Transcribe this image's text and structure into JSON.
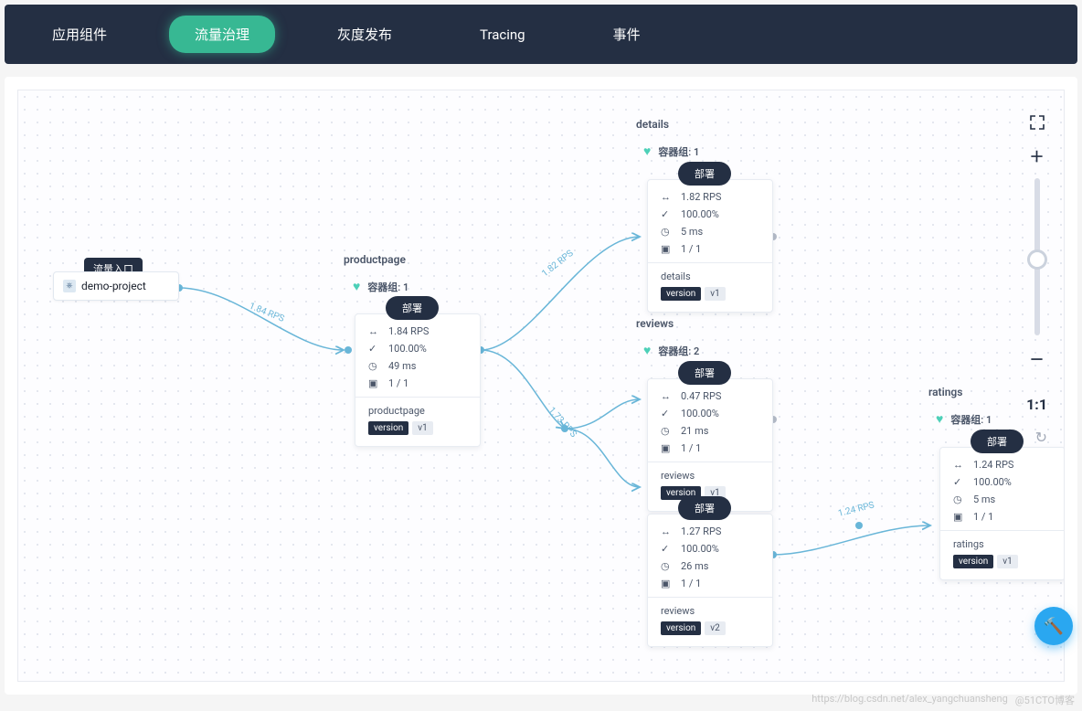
{
  "tabs": [
    {
      "label": "应用组件"
    },
    {
      "label": "流量治理"
    },
    {
      "label": "灰度发布"
    },
    {
      "label": "Tracing"
    },
    {
      "label": "事件"
    }
  ],
  "activeTab": 1,
  "ingress": {
    "label": "流量入口",
    "name": "demo-project"
  },
  "services": {
    "productpage": {
      "title": "productpage",
      "podLabel": "容器组: 1",
      "deploy": "部署",
      "stats": {
        "rps": "1.84 RPS",
        "success": "100.00%",
        "latency": "49 ms",
        "replicas": "1 / 1"
      },
      "footerName": "productpage",
      "tagKey": "version",
      "tagVal": "v1"
    },
    "details": {
      "title": "details",
      "podLabel": "容器组: 1",
      "deploy": "部署",
      "stats": {
        "rps": "1.82 RPS",
        "success": "100.00%",
        "latency": "5 ms",
        "replicas": "1 / 1"
      },
      "footerName": "details",
      "tagKey": "version",
      "tagVal": "v1"
    },
    "reviews": {
      "title": "reviews",
      "podLabel": "容器组: 2",
      "v1": {
        "deploy": "部署",
        "stats": {
          "rps": "0.47 RPS",
          "success": "100.00%",
          "latency": "21 ms",
          "replicas": "1 / 1"
        },
        "footerName": "reviews",
        "tagKey": "version",
        "tagVal": "v1"
      },
      "v2": {
        "deploy": "部署",
        "stats": {
          "rps": "1.27 RPS",
          "success": "100.00%",
          "latency": "26 ms",
          "replicas": "1 / 1"
        },
        "footerName": "reviews",
        "tagKey": "version",
        "tagVal": "v2"
      }
    },
    "ratings": {
      "title": "ratings",
      "podLabel": "容器组: 1",
      "deploy": "部署",
      "stats": {
        "rps": "1.24 RPS",
        "success": "100.00%",
        "latency": "5 ms",
        "replicas": "1 / 1"
      },
      "footerName": "ratings",
      "tagKey": "version",
      "tagVal": "v1"
    }
  },
  "links": {
    "l1": "1.84 RPS",
    "l2": "1.82 RPS",
    "l3": "1.73 RPS",
    "l4": "1.24 RPS"
  },
  "controls": {
    "fit": "1:1"
  },
  "watermark": {
    "a": "https://blog.csdn.net/alex_yangchuansheng",
    "b": "@51CTO博客"
  }
}
